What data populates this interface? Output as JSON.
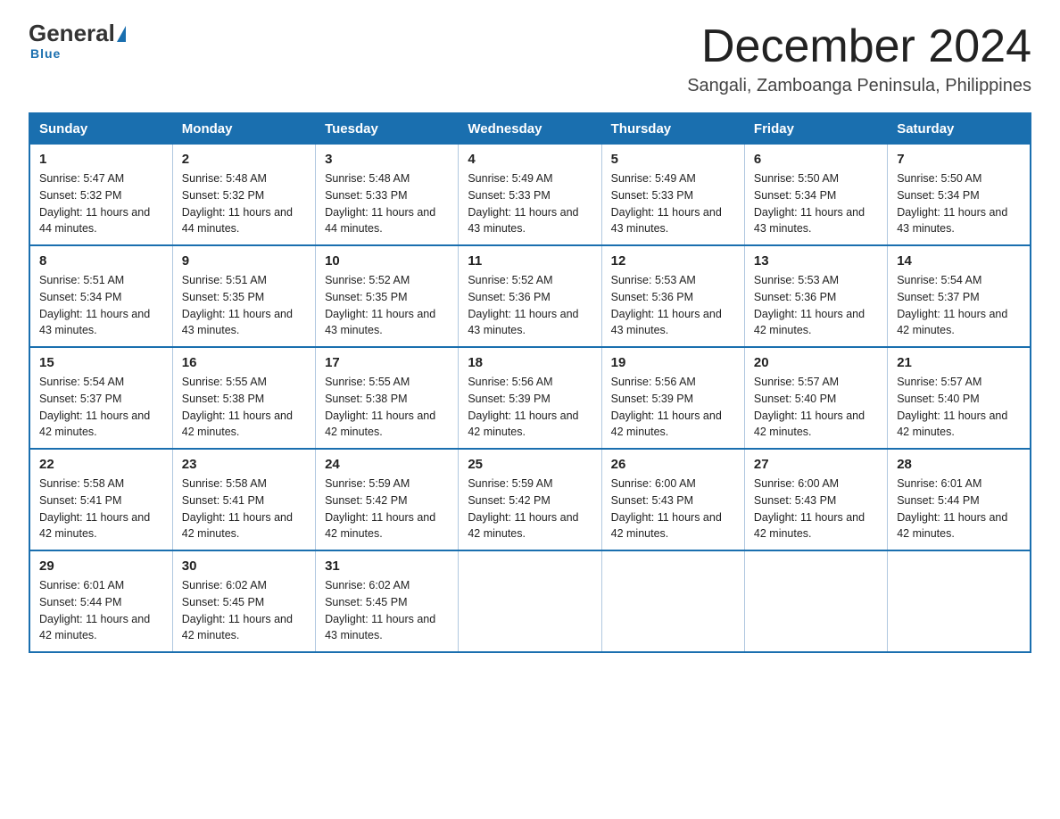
{
  "logo": {
    "general": "General",
    "blue": "Blue",
    "tagline": "Blue"
  },
  "header": {
    "month": "December 2024",
    "location": "Sangali, Zamboanga Peninsula, Philippines"
  },
  "weekdays": [
    "Sunday",
    "Monday",
    "Tuesday",
    "Wednesday",
    "Thursday",
    "Friday",
    "Saturday"
  ],
  "weeks": [
    [
      {
        "day": "1",
        "sunrise": "Sunrise: 5:47 AM",
        "sunset": "Sunset: 5:32 PM",
        "daylight": "Daylight: 11 hours and 44 minutes."
      },
      {
        "day": "2",
        "sunrise": "Sunrise: 5:48 AM",
        "sunset": "Sunset: 5:32 PM",
        "daylight": "Daylight: 11 hours and 44 minutes."
      },
      {
        "day": "3",
        "sunrise": "Sunrise: 5:48 AM",
        "sunset": "Sunset: 5:33 PM",
        "daylight": "Daylight: 11 hours and 44 minutes."
      },
      {
        "day": "4",
        "sunrise": "Sunrise: 5:49 AM",
        "sunset": "Sunset: 5:33 PM",
        "daylight": "Daylight: 11 hours and 43 minutes."
      },
      {
        "day": "5",
        "sunrise": "Sunrise: 5:49 AM",
        "sunset": "Sunset: 5:33 PM",
        "daylight": "Daylight: 11 hours and 43 minutes."
      },
      {
        "day": "6",
        "sunrise": "Sunrise: 5:50 AM",
        "sunset": "Sunset: 5:34 PM",
        "daylight": "Daylight: 11 hours and 43 minutes."
      },
      {
        "day": "7",
        "sunrise": "Sunrise: 5:50 AM",
        "sunset": "Sunset: 5:34 PM",
        "daylight": "Daylight: 11 hours and 43 minutes."
      }
    ],
    [
      {
        "day": "8",
        "sunrise": "Sunrise: 5:51 AM",
        "sunset": "Sunset: 5:34 PM",
        "daylight": "Daylight: 11 hours and 43 minutes."
      },
      {
        "day": "9",
        "sunrise": "Sunrise: 5:51 AM",
        "sunset": "Sunset: 5:35 PM",
        "daylight": "Daylight: 11 hours and 43 minutes."
      },
      {
        "day": "10",
        "sunrise": "Sunrise: 5:52 AM",
        "sunset": "Sunset: 5:35 PM",
        "daylight": "Daylight: 11 hours and 43 minutes."
      },
      {
        "day": "11",
        "sunrise": "Sunrise: 5:52 AM",
        "sunset": "Sunset: 5:36 PM",
        "daylight": "Daylight: 11 hours and 43 minutes."
      },
      {
        "day": "12",
        "sunrise": "Sunrise: 5:53 AM",
        "sunset": "Sunset: 5:36 PM",
        "daylight": "Daylight: 11 hours and 43 minutes."
      },
      {
        "day": "13",
        "sunrise": "Sunrise: 5:53 AM",
        "sunset": "Sunset: 5:36 PM",
        "daylight": "Daylight: 11 hours and 42 minutes."
      },
      {
        "day": "14",
        "sunrise": "Sunrise: 5:54 AM",
        "sunset": "Sunset: 5:37 PM",
        "daylight": "Daylight: 11 hours and 42 minutes."
      }
    ],
    [
      {
        "day": "15",
        "sunrise": "Sunrise: 5:54 AM",
        "sunset": "Sunset: 5:37 PM",
        "daylight": "Daylight: 11 hours and 42 minutes."
      },
      {
        "day": "16",
        "sunrise": "Sunrise: 5:55 AM",
        "sunset": "Sunset: 5:38 PM",
        "daylight": "Daylight: 11 hours and 42 minutes."
      },
      {
        "day": "17",
        "sunrise": "Sunrise: 5:55 AM",
        "sunset": "Sunset: 5:38 PM",
        "daylight": "Daylight: 11 hours and 42 minutes."
      },
      {
        "day": "18",
        "sunrise": "Sunrise: 5:56 AM",
        "sunset": "Sunset: 5:39 PM",
        "daylight": "Daylight: 11 hours and 42 minutes."
      },
      {
        "day": "19",
        "sunrise": "Sunrise: 5:56 AM",
        "sunset": "Sunset: 5:39 PM",
        "daylight": "Daylight: 11 hours and 42 minutes."
      },
      {
        "day": "20",
        "sunrise": "Sunrise: 5:57 AM",
        "sunset": "Sunset: 5:40 PM",
        "daylight": "Daylight: 11 hours and 42 minutes."
      },
      {
        "day": "21",
        "sunrise": "Sunrise: 5:57 AM",
        "sunset": "Sunset: 5:40 PM",
        "daylight": "Daylight: 11 hours and 42 minutes."
      }
    ],
    [
      {
        "day": "22",
        "sunrise": "Sunrise: 5:58 AM",
        "sunset": "Sunset: 5:41 PM",
        "daylight": "Daylight: 11 hours and 42 minutes."
      },
      {
        "day": "23",
        "sunrise": "Sunrise: 5:58 AM",
        "sunset": "Sunset: 5:41 PM",
        "daylight": "Daylight: 11 hours and 42 minutes."
      },
      {
        "day": "24",
        "sunrise": "Sunrise: 5:59 AM",
        "sunset": "Sunset: 5:42 PM",
        "daylight": "Daylight: 11 hours and 42 minutes."
      },
      {
        "day": "25",
        "sunrise": "Sunrise: 5:59 AM",
        "sunset": "Sunset: 5:42 PM",
        "daylight": "Daylight: 11 hours and 42 minutes."
      },
      {
        "day": "26",
        "sunrise": "Sunrise: 6:00 AM",
        "sunset": "Sunset: 5:43 PM",
        "daylight": "Daylight: 11 hours and 42 minutes."
      },
      {
        "day": "27",
        "sunrise": "Sunrise: 6:00 AM",
        "sunset": "Sunset: 5:43 PM",
        "daylight": "Daylight: 11 hours and 42 minutes."
      },
      {
        "day": "28",
        "sunrise": "Sunrise: 6:01 AM",
        "sunset": "Sunset: 5:44 PM",
        "daylight": "Daylight: 11 hours and 42 minutes."
      }
    ],
    [
      {
        "day": "29",
        "sunrise": "Sunrise: 6:01 AM",
        "sunset": "Sunset: 5:44 PM",
        "daylight": "Daylight: 11 hours and 42 minutes."
      },
      {
        "day": "30",
        "sunrise": "Sunrise: 6:02 AM",
        "sunset": "Sunset: 5:45 PM",
        "daylight": "Daylight: 11 hours and 42 minutes."
      },
      {
        "day": "31",
        "sunrise": "Sunrise: 6:02 AM",
        "sunset": "Sunset: 5:45 PM",
        "daylight": "Daylight: 11 hours and 43 minutes."
      },
      null,
      null,
      null,
      null
    ]
  ]
}
